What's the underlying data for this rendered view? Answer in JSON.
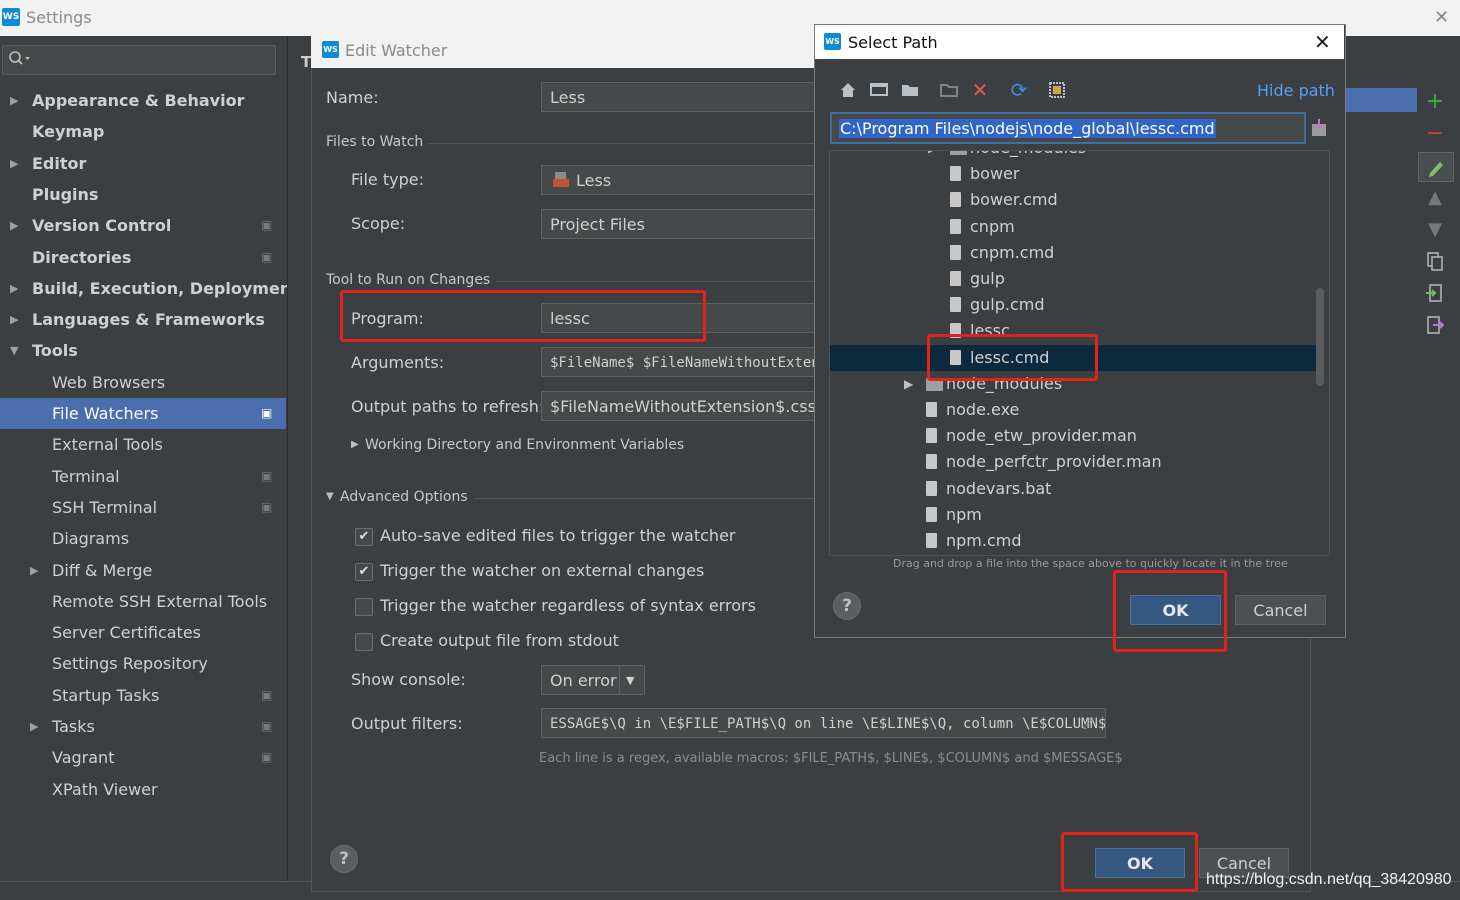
{
  "settings_window": {
    "title": "Settings",
    "logo_text": "WS",
    "close_glyph": "✕"
  },
  "sidebar": {
    "items": [
      {
        "label": "Appearance & Behavior",
        "bold": true,
        "expandable": true,
        "expanded": false,
        "project": false
      },
      {
        "label": "Keymap",
        "bold": true,
        "expandable": false,
        "project": false
      },
      {
        "label": "Editor",
        "bold": true,
        "expandable": true,
        "expanded": false,
        "project": false
      },
      {
        "label": "Plugins",
        "bold": true,
        "expandable": false,
        "project": false
      },
      {
        "label": "Version Control",
        "bold": true,
        "expandable": true,
        "expanded": false,
        "project": true
      },
      {
        "label": "Directories",
        "bold": true,
        "expandable": false,
        "project": true
      },
      {
        "label": "Build, Execution, Deployment",
        "bold": true,
        "expandable": true,
        "expanded": false,
        "project": false
      },
      {
        "label": "Languages & Frameworks",
        "bold": true,
        "expandable": true,
        "expanded": false,
        "project": false
      },
      {
        "label": "Tools",
        "bold": true,
        "expandable": true,
        "expanded": true,
        "project": false
      },
      {
        "label": "Web Browsers",
        "bold": false,
        "indent": true,
        "project": false
      },
      {
        "label": "File Watchers",
        "bold": false,
        "indent": true,
        "project": true,
        "selected": true
      },
      {
        "label": "External Tools",
        "bold": false,
        "indent": true,
        "project": false
      },
      {
        "label": "Terminal",
        "bold": false,
        "indent": true,
        "project": true
      },
      {
        "label": "SSH Terminal",
        "bold": false,
        "indent": true,
        "project": true
      },
      {
        "label": "Diagrams",
        "bold": false,
        "indent": true,
        "project": false
      },
      {
        "label": "Diff & Merge",
        "bold": false,
        "indent": true,
        "expandable": true,
        "expanded": false,
        "project": false
      },
      {
        "label": "Remote SSH External Tools",
        "bold": false,
        "indent": true,
        "project": false
      },
      {
        "label": "Server Certificates",
        "bold": false,
        "indent": true,
        "project": false
      },
      {
        "label": "Settings Repository",
        "bold": false,
        "indent": true,
        "project": false
      },
      {
        "label": "Startup Tasks",
        "bold": false,
        "indent": true,
        "project": true
      },
      {
        "label": "Tasks",
        "bold": false,
        "indent": true,
        "expandable": true,
        "expanded": false,
        "project": true
      },
      {
        "label": "Vagrant",
        "bold": false,
        "indent": true,
        "project": true
      },
      {
        "label": "XPath Viewer",
        "bold": false,
        "indent": true,
        "project": false
      }
    ],
    "project_glyph": "▣"
  },
  "main_panel": {
    "header_letter": "T"
  },
  "edit_watcher": {
    "title": "Edit Watcher",
    "logo_text": "WS",
    "name_label": "Name:",
    "name_value": "Less",
    "files_to_watch_section": "Files to Watch",
    "file_type_label": "File type:",
    "file_type_value": "Less",
    "scope_label": "Scope:",
    "scope_value": "Project Files",
    "tool_section": "Tool to Run on Changes",
    "program_label": "Program:",
    "program_value": "lessc",
    "arguments_label": "Arguments:",
    "arguments_value": "$FileName$ $FileNameWithoutExtens",
    "output_paths_label": "Output paths to refresh:",
    "output_paths_value": "$FileNameWithoutExtension$.css:$F",
    "working_dir_label": "Working Directory and Environment Variables",
    "advanced_section": "Advanced Options",
    "checkboxes": [
      {
        "label": "Auto-save edited files to trigger the watcher",
        "checked": true
      },
      {
        "label": "Trigger the watcher on external changes",
        "checked": true
      },
      {
        "label": "Trigger the watcher regardless of syntax errors",
        "checked": false
      },
      {
        "label": "Create output file from stdout",
        "checked": false
      }
    ],
    "show_console_label": "Show console:",
    "show_console_value": "On error",
    "output_filters_label": "Output filters:",
    "output_filters_value": "ESSAGE$\\Q in \\E$FILE_PATH$\\Q on line \\E$LINE$\\Q, column \\E$COLUMN$",
    "filters_hint": "Each line is a regex, available macros: $FILE_PATH$, $LINE$, $COLUMN$ and $MESSAGE$",
    "ok_label": "OK",
    "cancel_label": "Cancel",
    "help_glyph": "?"
  },
  "select_path": {
    "title": "Select Path",
    "logo_text": "WS",
    "close_glyph": "✕",
    "hide_path_label": "Hide path",
    "path_value": "C:\\Program Files\\nodejs\\node_global\\lessc.cmd",
    "toolbar_icons": [
      "home-icon",
      "desktop-icon",
      "project-folder-icon",
      "new-folder-icon",
      "delete-icon",
      "refresh-icon",
      "show-hidden-icon"
    ],
    "tree": [
      {
        "label": "node_modules",
        "type": "folder",
        "level": 2,
        "expandable": true
      },
      {
        "label": "bower",
        "type": "file",
        "level": 2
      },
      {
        "label": "bower.cmd",
        "type": "file",
        "level": 2
      },
      {
        "label": "cnpm",
        "type": "file",
        "level": 2
      },
      {
        "label": "cnpm.cmd",
        "type": "file",
        "level": 2
      },
      {
        "label": "gulp",
        "type": "file",
        "level": 2
      },
      {
        "label": "gulp.cmd",
        "type": "file",
        "level": 2
      },
      {
        "label": "lessc",
        "type": "file",
        "level": 2
      },
      {
        "label": "lessc.cmd",
        "type": "file",
        "level": 2,
        "selected": true
      },
      {
        "label": "node_modules",
        "type": "folder",
        "level": 1,
        "expandable": true
      },
      {
        "label": "node.exe",
        "type": "exe",
        "level": 1
      },
      {
        "label": "node_etw_provider.man",
        "type": "file",
        "level": 1
      },
      {
        "label": "node_perfctr_provider.man",
        "type": "file",
        "level": 1
      },
      {
        "label": "nodevars.bat",
        "type": "file",
        "level": 1
      },
      {
        "label": "npm",
        "type": "file",
        "level": 1
      },
      {
        "label": "npm.cmd",
        "type": "file",
        "level": 1
      }
    ],
    "hint": "Drag and drop a file into the space above to quickly locate it in the tree",
    "ok_label": "OK",
    "cancel_label": "Cancel",
    "help_glyph": "?"
  },
  "watermark": "https://blog.csdn.net/qq_38420980",
  "colors": {
    "background": "#3c3f41",
    "selection": "#4b6eaf",
    "tree_selection": "#0d293e",
    "primary_button": "#365880",
    "highlight_box": "#e0241a",
    "link": "#589df6",
    "add_green": "#3fae3a",
    "remove_red": "#c8432f"
  }
}
